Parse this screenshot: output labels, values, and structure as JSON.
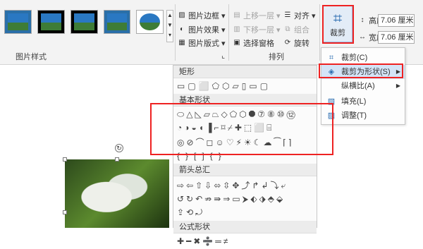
{
  "ribbon": {
    "picture_styles_label": "图片样式",
    "arrange_label": "排列",
    "picture_border": "图片边框",
    "picture_effects": "图片效果",
    "picture_layout": "图片版式",
    "bring_forward": "上移一层",
    "send_backward": "下移一层",
    "selection_pane": "选择窗格",
    "align": "对齐",
    "group": "组合",
    "rotate": "旋转",
    "crop": "裁剪",
    "height_label": "高度:",
    "height_value": "7.06 厘米",
    "width_label": "宽度:",
    "width_value": "7.06 厘米",
    "dialog_launcher": "⌞"
  },
  "crop_menu": {
    "items": [
      {
        "label": "裁剪(C)",
        "icon": "crop-icon"
      },
      {
        "label": "裁剪为形状(S)",
        "icon": "crop-to-shape-icon",
        "has_submenu": true
      },
      {
        "label": "纵横比(A)",
        "icon": "",
        "has_submenu": true
      },
      {
        "label": "填充(L)",
        "icon": "fill-icon"
      },
      {
        "label": "调整(T)",
        "icon": "fit-icon"
      }
    ]
  },
  "shapes_panel": {
    "rectangles_label": "矩形",
    "basic_shapes_label": "基本形状",
    "block_arrows_label": "箭头总汇",
    "equation_shapes_label": "公式形状",
    "rectangles": "▭▢⬜⬠⬡▱▯▭▢",
    "basic_row1": "⬭△◺▱⏢◇⬠⬡⯃⑦⑧⑩⑫",
    "basic_row2": "◔◑◒◖▐⌐⌑⌿✚⬚⬜⌸",
    "basic_row3": "◎⊘⌒◻☺♡⚡☀☾☁⁀⌈⌉",
    "basic_row4": "{}[]{}",
    "arrows_row1": "⇨⇦⇧⇩⬄⇳✥⤴↱↲⤵⤶",
    "arrows_row2": "↺↻↶⇏⇛⇒▭⮞⬖⬗⬘⬙",
    "arrows_row3": "⇪⟲⤾",
    "equation_row": "✚━✖➗═≠"
  },
  "colors": {
    "highlight_red": "#e22222",
    "menu_hover": "#d4e4f7",
    "accent_blue": "#2b6cb0"
  }
}
